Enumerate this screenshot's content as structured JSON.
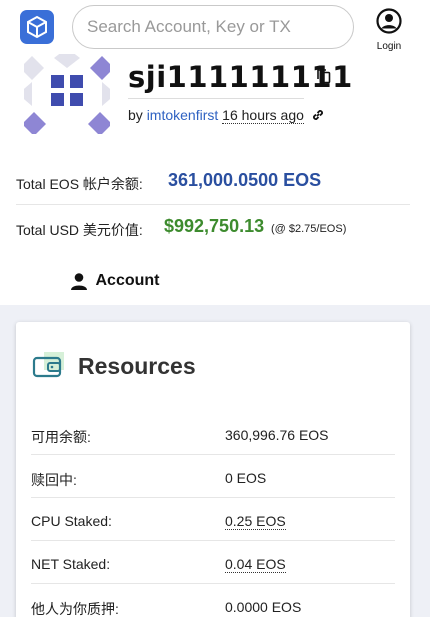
{
  "header": {
    "search_placeholder": "Search Account, Key or TX",
    "login_label": "Login"
  },
  "account": {
    "name": "sji111111111",
    "by_prefix": "by",
    "creator": "imtokenfirst",
    "created_ago": "16 hours ago"
  },
  "balances": {
    "eos_label": "Total EOS 帐户余额:",
    "eos_value": "361,000.0500 EOS",
    "usd_label": "Total USD 美元价值:",
    "usd_value": "$992,750.13",
    "usd_rate": "(@ $2.75/EOS)"
  },
  "tabs": [
    {
      "label": "Account",
      "active": true
    }
  ],
  "resources": {
    "title": "Resources",
    "rows": [
      {
        "label": "可用余额:",
        "value": "360,996.76 EOS"
      },
      {
        "label": "赎回中:",
        "value": "0 EOS"
      },
      {
        "label": "CPU Staked:",
        "value": "0.25 EOS"
      },
      {
        "label": "NET Staked:",
        "value": "0.04 EOS"
      },
      {
        "label": "他人为你质押:",
        "value": "0.0000 EOS"
      }
    ]
  },
  "colors": {
    "eos_value": "#2a4fa0",
    "usd_value": "#3d8b2e",
    "creator_link": "#2f62c2",
    "logo": "#3a6fd8",
    "avatar_squares": "#3f4cae"
  }
}
